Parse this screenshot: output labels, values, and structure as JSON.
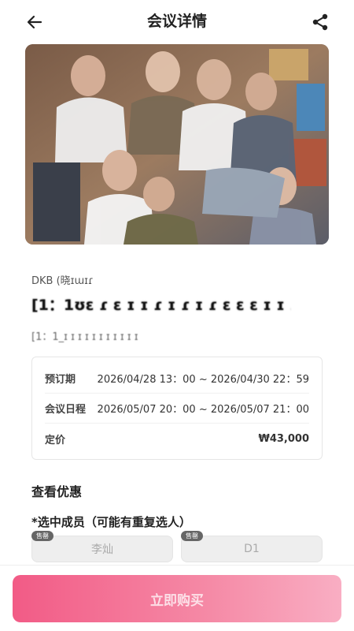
{
  "header": {
    "title": "会议详情"
  },
  "product": {
    "artist": "DKB (晓ɪɯɪɾ",
    "name": "[1：1ʊɛ ɾ ɛ ɪ ɪ ɾ ɪ ɾ ɪ ɾ ɛ ɛ ɛ ɪ ɪ ɾ ɪ ɛ ɾ ɾ",
    "subtitle": "[1：1_ɪ ɪ ɪ ɪ ɪ ɪ ɪ ɪ ɪ ɪ ɪ"
  },
  "info": {
    "reservation_label": "预订期",
    "reservation_value": "2026/04/28 13：00 ~ 2026/04/30 22：59",
    "schedule_label": "会议日程",
    "schedule_value": "2026/05/07 20：00 ~ 2026/05/07 21：00",
    "price_label": "定价",
    "price_value": "₩43,000"
  },
  "discount": {
    "section_title": "查看优惠",
    "member_label": "*选中成员（可能有重复选人）",
    "members": [
      {
        "name": "李灿",
        "badge": "售罄"
      },
      {
        "name": "D1",
        "badge": "售罄"
      }
    ]
  },
  "footer": {
    "buy_label": "立即购买"
  },
  "icons": {
    "back": "arrow-left-icon",
    "share": "share-icon"
  },
  "colors": {
    "accent_start": "#f25b86",
    "accent_end": "#f9aec3"
  }
}
